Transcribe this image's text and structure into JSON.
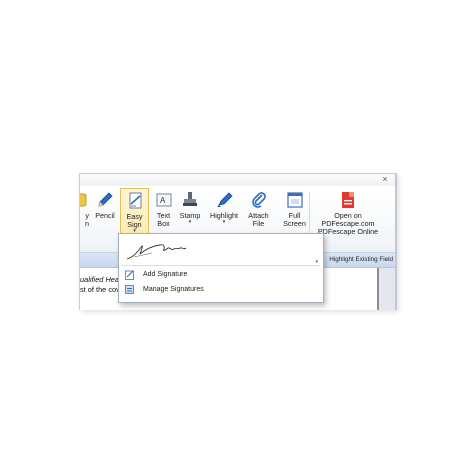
{
  "toolbar": {
    "partial_left": [
      "y",
      "n"
    ],
    "buttons": [
      {
        "label": "Pencil",
        "icon": "pencil-icon"
      },
      {
        "label": "Easy Sign",
        "label_lines": [
          "Easy",
          "Sign"
        ],
        "icon": "easy-sign-icon",
        "selected": true,
        "has_dropdown": true
      },
      {
        "label": "Text Box",
        "label_lines": [
          "Text",
          "Box"
        ],
        "icon": "text-box-icon"
      },
      {
        "label": "Stamp",
        "icon": "stamp-icon",
        "has_dropdown": true
      },
      {
        "label": "Highlight",
        "icon": "highlighter-icon",
        "has_dropdown": true
      },
      {
        "label": "Attach File",
        "label_lines": [
          "Attach",
          "File"
        ],
        "icon": "paperclip-icon"
      },
      {
        "label": "Full Screen",
        "label_lines": [
          "Full",
          "Screen"
        ],
        "icon": "full-screen-icon"
      },
      {
        "label": "Open on PDFescape.com PDFescape Online",
        "label_lines": [
          "Open on",
          "PDFescape.com",
          "PDFescape Online"
        ],
        "icon": "pdf-online-icon"
      }
    ]
  },
  "document": {
    "bar_text": "Highlight Existing Field",
    "lines": [
      "ualified Hea",
      "st of the coverage."
    ]
  },
  "easy_sign_menu": {
    "items": [
      {
        "label": "Add Signature",
        "icon": "add-signature-icon"
      },
      {
        "label": "Manage Signatures",
        "icon": "manage-signatures-icon"
      }
    ]
  },
  "colors": {
    "accent_pdf_red": "#e03a2f",
    "selected_button": "#fde9a8",
    "icon_blue": "#2b6cc4"
  }
}
